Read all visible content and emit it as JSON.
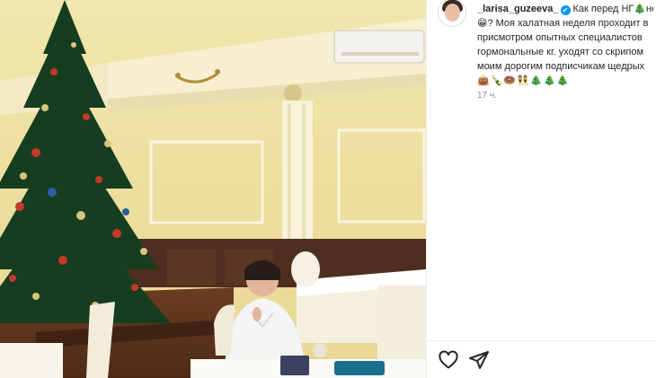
{
  "post": {
    "username": "_larisa_guzeeva_",
    "verified_glyph": "✔",
    "caption_lines": [
      "Как перед НГ🎄не",
      "😁? Моя халатная неделя проходит в",
      "присмотром опытных специалистов",
      "гормональные кг. уходят со скрипом",
      "моим дорогим подписчикам щедрых"
    ],
    "caption_emoji": "👜🍾🍩👯🎄🎄🎄",
    "timestamp": "17 ч."
  },
  "actions": {
    "like_icon": "heart-icon",
    "share_icon": "paper-plane-icon"
  },
  "colors": {
    "accent": "#0095f6",
    "wall": "#efe3a6",
    "tree": "#163d1f"
  }
}
